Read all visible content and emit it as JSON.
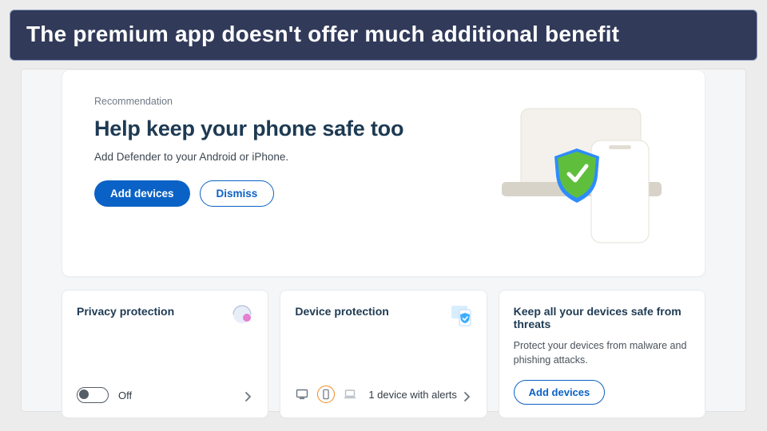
{
  "caption": "The premium app doesn't offer much additional benefit",
  "recommendation": {
    "eyebrow": "Recommendation",
    "title": "Help keep your phone safe too",
    "subtitle": "Add Defender to your Android or iPhone.",
    "primary_btn": "Add devices",
    "secondary_btn": "Dismiss"
  },
  "tiles": {
    "privacy": {
      "title": "Privacy protection",
      "toggle_state": "off",
      "toggle_label": "Off"
    },
    "device": {
      "title": "Device protection",
      "status_text": "1 device with alerts"
    },
    "promo": {
      "title": "Keep all your devices safe from threats",
      "subtitle": "Protect your devices from malware and phishing attacks.",
      "button": "Add devices"
    }
  },
  "colors": {
    "accent_blue": "#0b62c6",
    "heading": "#1e3a53",
    "caption_bg": "#313a59"
  }
}
